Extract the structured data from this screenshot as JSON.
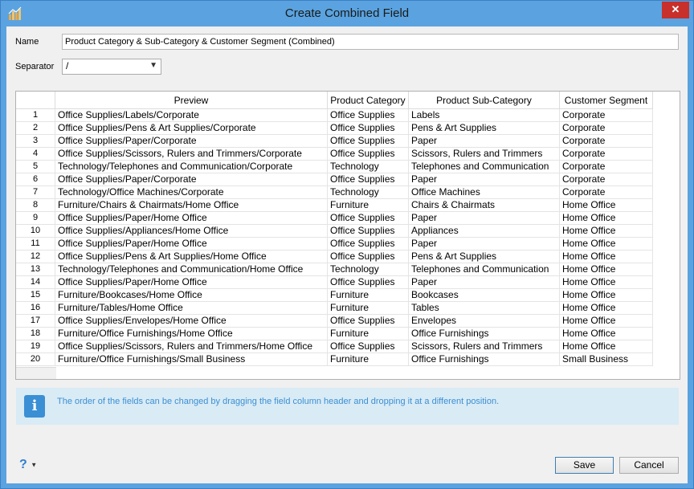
{
  "window": {
    "title": "Create Combined Field",
    "close_label": "✕"
  },
  "form": {
    "name_label": "Name",
    "name_value": "Product Category & Sub-Category & Customer Segment (Combined)",
    "separator_label": "Separator",
    "separator_value": "/"
  },
  "grid": {
    "columns": [
      "Preview",
      "Product Category",
      "Product Sub-Category",
      "Customer Segment"
    ],
    "rows": [
      {
        "n": "1",
        "preview": "Office Supplies/Labels/Corporate",
        "cat": "Office Supplies",
        "sub": "Labels",
        "seg": "Corporate"
      },
      {
        "n": "2",
        "preview": "Office Supplies/Pens & Art Supplies/Corporate",
        "cat": "Office Supplies",
        "sub": "Pens & Art Supplies",
        "seg": "Corporate"
      },
      {
        "n": "3",
        "preview": "Office Supplies/Paper/Corporate",
        "cat": "Office Supplies",
        "sub": "Paper",
        "seg": "Corporate"
      },
      {
        "n": "4",
        "preview": "Office Supplies/Scissors, Rulers and Trimmers/Corporate",
        "cat": "Office Supplies",
        "sub": "Scissors, Rulers and Trimmers",
        "seg": "Corporate"
      },
      {
        "n": "5",
        "preview": "Technology/Telephones and Communication/Corporate",
        "cat": "Technology",
        "sub": "Telephones and Communication",
        "seg": "Corporate"
      },
      {
        "n": "6",
        "preview": "Office Supplies/Paper/Corporate",
        "cat": "Office Supplies",
        "sub": "Paper",
        "seg": "Corporate"
      },
      {
        "n": "7",
        "preview": "Technology/Office Machines/Corporate",
        "cat": "Technology",
        "sub": "Office Machines",
        "seg": "Corporate"
      },
      {
        "n": "8",
        "preview": "Furniture/Chairs & Chairmats/Home Office",
        "cat": "Furniture",
        "sub": "Chairs & Chairmats",
        "seg": "Home Office"
      },
      {
        "n": "9",
        "preview": "Office Supplies/Paper/Home Office",
        "cat": "Office Supplies",
        "sub": "Paper",
        "seg": "Home Office"
      },
      {
        "n": "10",
        "preview": "Office Supplies/Appliances/Home Office",
        "cat": "Office Supplies",
        "sub": "Appliances",
        "seg": "Home Office"
      },
      {
        "n": "11",
        "preview": "Office Supplies/Paper/Home Office",
        "cat": "Office Supplies",
        "sub": "Paper",
        "seg": "Home Office"
      },
      {
        "n": "12",
        "preview": "Office Supplies/Pens & Art Supplies/Home Office",
        "cat": "Office Supplies",
        "sub": "Pens & Art Supplies",
        "seg": "Home Office"
      },
      {
        "n": "13",
        "preview": "Technology/Telephones and Communication/Home Office",
        "cat": "Technology",
        "sub": "Telephones and Communication",
        "seg": "Home Office"
      },
      {
        "n": "14",
        "preview": "Office Supplies/Paper/Home Office",
        "cat": "Office Supplies",
        "sub": "Paper",
        "seg": "Home Office"
      },
      {
        "n": "15",
        "preview": "Furniture/Bookcases/Home Office",
        "cat": "Furniture",
        "sub": "Bookcases",
        "seg": "Home Office"
      },
      {
        "n": "16",
        "preview": "Furniture/Tables/Home Office",
        "cat": "Furniture",
        "sub": "Tables",
        "seg": "Home Office"
      },
      {
        "n": "17",
        "preview": "Office Supplies/Envelopes/Home Office",
        "cat": "Office Supplies",
        "sub": "Envelopes",
        "seg": "Home Office"
      },
      {
        "n": "18",
        "preview": "Furniture/Office Furnishings/Home Office",
        "cat": "Furniture",
        "sub": "Office Furnishings",
        "seg": "Home Office"
      },
      {
        "n": "19",
        "preview": "Office Supplies/Scissors, Rulers and Trimmers/Home Office",
        "cat": "Office Supplies",
        "sub": "Scissors, Rulers and Trimmers",
        "seg": "Home Office"
      },
      {
        "n": "20",
        "preview": "Furniture/Office Furnishings/Small Business",
        "cat": "Furniture",
        "sub": "Office Furnishings",
        "seg": "Small Business"
      }
    ]
  },
  "info": {
    "icon": "info-icon",
    "text": "The order of the fields can be changed by dragging the field column header and dropping it at a different position."
  },
  "footer": {
    "help_label": "?",
    "save_label": "Save",
    "cancel_label": "Cancel"
  },
  "colors": {
    "titlebar": "#5aa3e0",
    "close": "#c7302b",
    "info_bg": "#d9ebf5",
    "info_text": "#3b8fd4"
  }
}
